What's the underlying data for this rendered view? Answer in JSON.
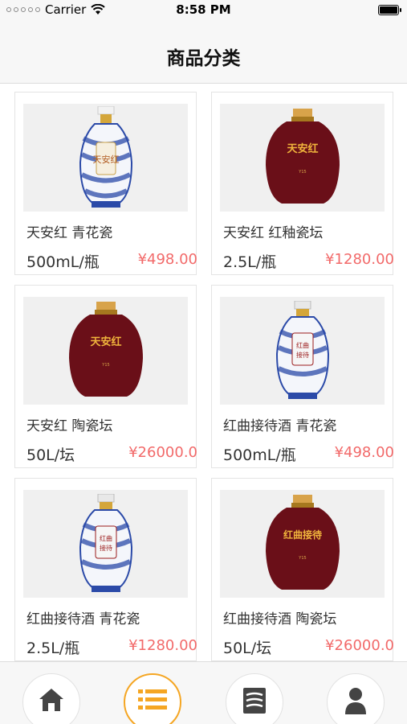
{
  "status_bar": {
    "carrier": "Carrier",
    "time": "8:58 PM"
  },
  "nav": {
    "title": "商品分类"
  },
  "products": [
    {
      "name": "天安红 青花瓷",
      "spec": "500mL/瓶",
      "price": "¥498.00",
      "bottle": "blue-white",
      "label": "天安红"
    },
    {
      "name": "天安红 红釉瓷坛",
      "spec": "2.5L/瓶",
      "price": "¥1280.00",
      "bottle": "red-jar",
      "label": "天安红"
    },
    {
      "name": "天安红 陶瓷坛",
      "spec": "50L/坛",
      "price": "¥26000.0",
      "bottle": "red-jar",
      "label": "天安红"
    },
    {
      "name": "红曲接待酒 青花瓷",
      "spec": "500mL/瓶",
      "price": "¥498.00",
      "bottle": "blue-white",
      "label": "红曲接待"
    },
    {
      "name": "红曲接待酒 青花瓷",
      "spec": "2.5L/瓶",
      "price": "¥1280.00",
      "bottle": "blue-white",
      "label": "红曲接待"
    },
    {
      "name": "红曲接待酒 陶瓷坛",
      "spec": "50L/坛",
      "price": "¥26000.0",
      "bottle": "red-jar",
      "label": "红曲接待"
    }
  ],
  "tabs": [
    {
      "icon": "home-icon",
      "active": false
    },
    {
      "icon": "category-list-icon",
      "active": true
    },
    {
      "icon": "document-icon",
      "active": false
    },
    {
      "icon": "user-icon",
      "active": false
    }
  ],
  "colors": {
    "price": "#f26a6a",
    "active_tab": "#f5a623",
    "icon": "#444444"
  }
}
